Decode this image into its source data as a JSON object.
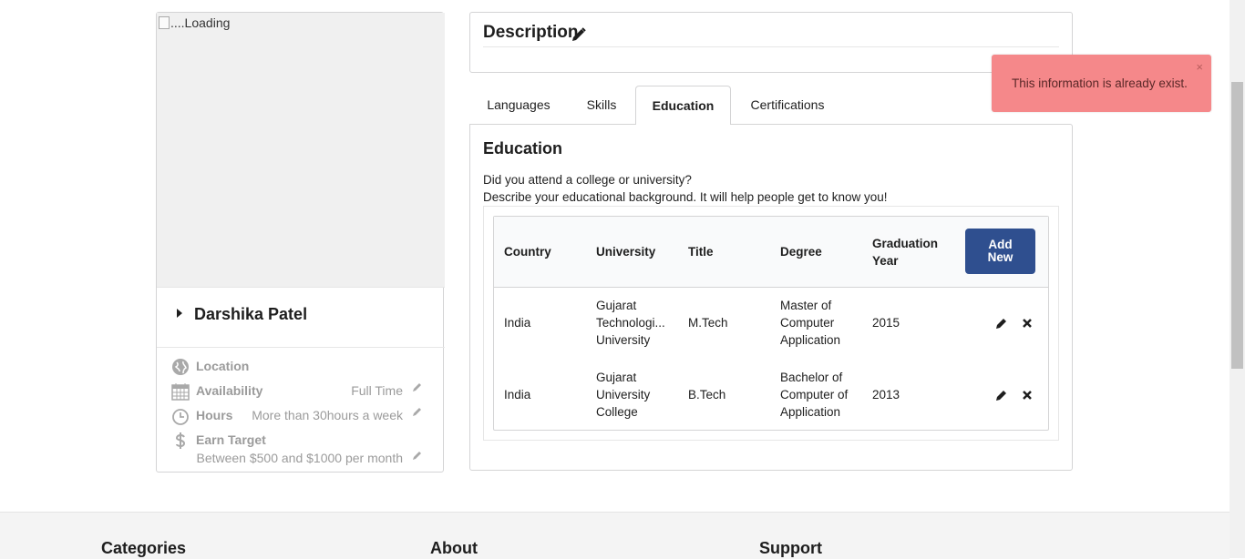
{
  "profile": {
    "image_alt": "....Loading",
    "name": "Darshika Patel",
    "details": [
      {
        "icon": "globe-icon",
        "label": "Location",
        "value": ""
      },
      {
        "icon": "calendar-icon",
        "label": "Availability",
        "value": "Full Time"
      },
      {
        "icon": "clock-icon",
        "label": "Hours",
        "value": "More than 30hours a week"
      },
      {
        "icon": "dollar-icon",
        "label": "Earn Target",
        "value": "Between $500 and $1000 per month"
      }
    ]
  },
  "description": {
    "title": "Description"
  },
  "tabs": [
    {
      "label": "Languages",
      "active": false
    },
    {
      "label": "Skills",
      "active": false
    },
    {
      "label": "Education",
      "active": true
    },
    {
      "label": "Certifications",
      "active": false
    }
  ],
  "education": {
    "title": "Education",
    "question": "Did you attend a college or university?",
    "description": "Describe your educational background. It will help people get to know you!",
    "columns": [
      "Country",
      "University",
      "Title",
      "Degree",
      "Graduation Year"
    ],
    "add_button": "Add New",
    "rows": [
      {
        "country": "India",
        "university": "Gujarat Technologi... University",
        "title": "M.Tech",
        "degree": "Master of Computer Application",
        "year": "2015"
      },
      {
        "country": "India",
        "university": "Gujarat University College",
        "title": "B.Tech",
        "degree": "Bachelor of Computer of Application",
        "year": "2013"
      }
    ]
  },
  "toast": {
    "message": "This information is already exist.",
    "close": "×"
  },
  "footer": {
    "headings": [
      "Categories",
      "About",
      "Support"
    ]
  },
  "colors": {
    "primary_button": "#2f4f8f",
    "toast_bg": "#f5888a",
    "muted_text": "#9b9b9b"
  }
}
